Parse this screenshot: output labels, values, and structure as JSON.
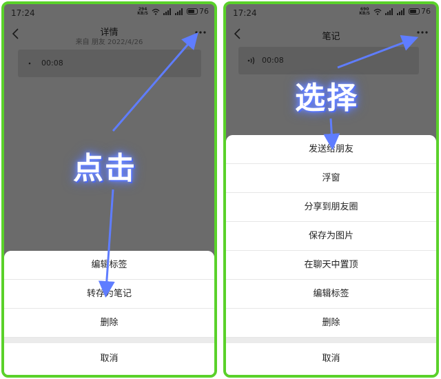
{
  "left": {
    "status": {
      "time": "17:24",
      "speed_value": "294",
      "speed_unit": "KB/S",
      "battery": "76"
    },
    "nav": {
      "title": "详情",
      "subtitle": "来自 朋友 2022/4/26"
    },
    "voice": {
      "duration": "00:08"
    },
    "menu": {
      "items": [
        "编辑标签",
        "转存为笔记",
        "删除"
      ],
      "cancel": "取消"
    },
    "overlay": "点击"
  },
  "right": {
    "status": {
      "time": "17:24",
      "speed_value": "690",
      "speed_unit": "KB/S",
      "battery": "76"
    },
    "nav": {
      "title": "笔记"
    },
    "voice": {
      "duration": "00:08"
    },
    "menu": {
      "items": [
        "发送给朋友",
        "浮窗",
        "分享到朋友圈",
        "保存为图片",
        "在聊天中置顶",
        "编辑标签",
        "删除"
      ],
      "cancel": "取消"
    },
    "overlay": "选择"
  },
  "colors": {
    "frame": "#5ad12a",
    "arrow": "#5f7dff",
    "dim_background": "#6b6b6b"
  },
  "icons": [
    "back-icon",
    "more-icon",
    "wifi-icon",
    "signal-icon",
    "battery-icon",
    "voice-icon"
  ]
}
